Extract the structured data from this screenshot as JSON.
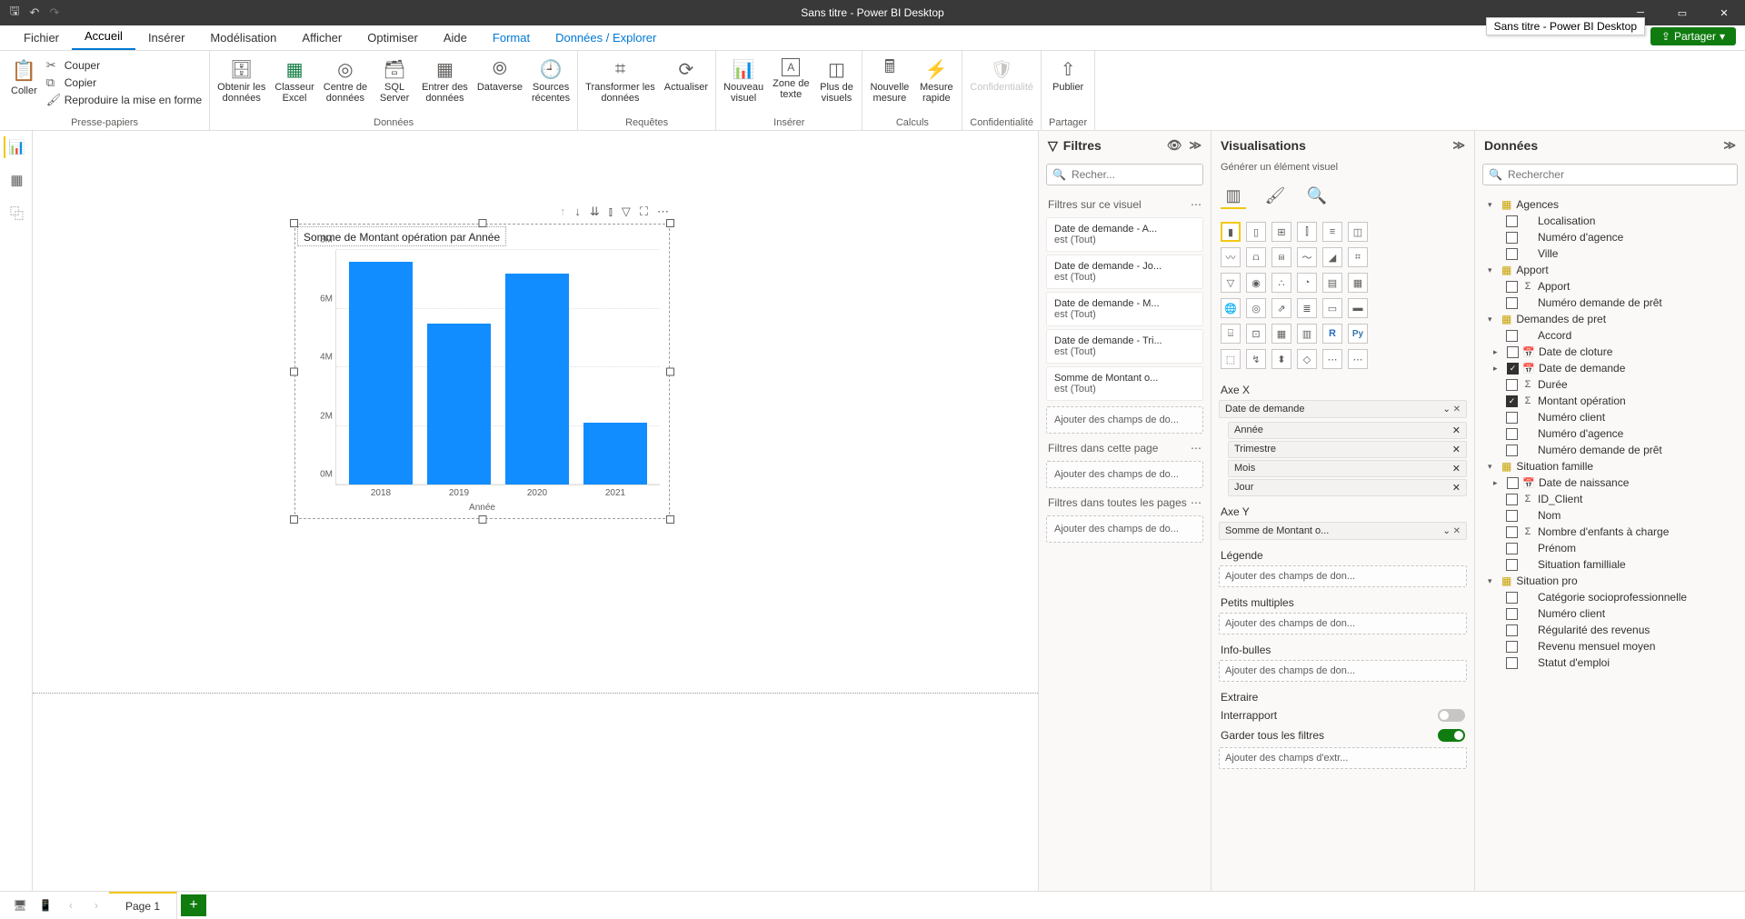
{
  "titlebar": {
    "title": "Sans titre - Power BI Desktop",
    "tooltip": "Sans titre - Power BI Desktop"
  },
  "share": "Partager",
  "tabs": {
    "fichier": "Fichier",
    "accueil": "Accueil",
    "inserer": "Insérer",
    "modelisation": "Modélisation",
    "afficher": "Afficher",
    "optimiser": "Optimiser",
    "aide": "Aide",
    "format": "Format",
    "donnees": "Données / Explorer"
  },
  "ribbon": {
    "clipboard": {
      "coller": "Coller",
      "couper": "Couper",
      "copier": "Copier",
      "reproduire": "Reproduire la mise en forme",
      "group": "Presse-papiers"
    },
    "data": {
      "obtenir": "Obtenir les\ndonnées",
      "excel": "Classeur\nExcel",
      "hub": "Centre de\ndonnées",
      "sql": "SQL\nServer",
      "entrer": "Entrer des\ndonnées",
      "dataverse": "Dataverse",
      "recentes": "Sources\nrécentes",
      "group": "Données"
    },
    "queries": {
      "transformer": "Transformer les\ndonnées",
      "actualiser": "Actualiser",
      "group": "Requêtes"
    },
    "insert": {
      "visuel": "Nouveau\nvisuel",
      "texte": "Zone de\ntexte",
      "plus": "Plus de\nvisuels",
      "group": "Insérer"
    },
    "calc": {
      "mesure": "Nouvelle\nmesure",
      "rapide": "Mesure\nrapide",
      "group": "Calculs"
    },
    "conf": {
      "label": "Confidentialité",
      "group": "Confidentialité"
    },
    "share": {
      "publier": "Publier",
      "group": "Partager"
    }
  },
  "chart_data": {
    "type": "bar",
    "title": "Somme de Montant opération par Année",
    "xlabel": "Année",
    "ylabel": "Somme de Montant opération",
    "categories": [
      "2018",
      "2019",
      "2020",
      "2021"
    ],
    "values": [
      7600000,
      5500000,
      7200000,
      2100000
    ],
    "y_ticks": [
      "0M",
      "2M",
      "4M",
      "6M",
      "8M"
    ],
    "ylim": [
      0,
      8000000
    ]
  },
  "filters": {
    "title": "Filtres",
    "search_placeholder": "Recher...",
    "on_visual": "Filtres sur ce visuel",
    "cards": [
      {
        "l1": "Date de demande - A...",
        "l2": "est (Tout)"
      },
      {
        "l1": "Date de demande - Jo...",
        "l2": "est (Tout)"
      },
      {
        "l1": "Date de demande - M...",
        "l2": "est (Tout)"
      },
      {
        "l1": "Date de demande - Tri...",
        "l2": "est (Tout)"
      },
      {
        "l1": "Somme de Montant o...",
        "l2": "est (Tout)"
      }
    ],
    "add": "Ajouter des champs de do...",
    "on_page": "Filtres dans cette page",
    "on_all": "Filtres dans toutes les pages"
  },
  "viz": {
    "title": "Visualisations",
    "subtitle": "Générer un élément visuel",
    "axe_x": "Axe X",
    "axe_y": "Axe Y",
    "legende": "Légende",
    "petits": "Petits multiples",
    "infobulles": "Info-bulles",
    "extraire": "Extraire",
    "interrapport": "Interrapport",
    "garder": "Garder tous les filtres",
    "extraire_drop": "Ajouter des champs d'extr...",
    "add_drop": "Ajouter des champs de don...",
    "x_field": "Date de demande",
    "x_subs": [
      "Année",
      "Trimestre",
      "Mois",
      "Jour"
    ],
    "y_field": "Somme de Montant o..."
  },
  "data_pane": {
    "title": "Données",
    "search_placeholder": "Rechercher",
    "tables": {
      "agences": {
        "name": "Agences",
        "fields": [
          "Localisation",
          "Numéro d'agence",
          "Ville"
        ]
      },
      "apport": {
        "name": "Apport",
        "fields": [
          {
            "n": "Apport",
            "sigma": true
          },
          {
            "n": "Numéro demande de prêt"
          }
        ]
      },
      "demandes": {
        "name": "Demandes de pret",
        "fields": [
          {
            "n": "Accord"
          },
          {
            "n": "Date de cloture",
            "cal": true,
            "expand": true
          },
          {
            "n": "Date de demande",
            "cal": true,
            "expand": true,
            "checked": true
          },
          {
            "n": "Durée",
            "sigma": true
          },
          {
            "n": "Montant opération",
            "sigma": true,
            "checked": true
          },
          {
            "n": "Numéro client"
          },
          {
            "n": "Numéro d'agence"
          },
          {
            "n": "Numéro demande de prêt"
          }
        ]
      },
      "famille": {
        "name": "Situation famille",
        "fields": [
          {
            "n": "Date de naissance",
            "cal": true,
            "expand": true
          },
          {
            "n": "ID_Client",
            "sigma": true
          },
          {
            "n": "Nom"
          },
          {
            "n": "Nombre d'enfants à charge",
            "sigma": true
          },
          {
            "n": "Prénom"
          },
          {
            "n": "Situation familliale"
          }
        ]
      },
      "pro": {
        "name": "Situation pro",
        "fields": [
          {
            "n": "Catégorie socioprofessionnelle"
          },
          {
            "n": "Numéro client"
          },
          {
            "n": "Régularité des revenus"
          },
          {
            "n": "Revenu mensuel moyen"
          },
          {
            "n": "Statut d'emploi"
          }
        ]
      }
    }
  },
  "page_tab": "Page 1"
}
